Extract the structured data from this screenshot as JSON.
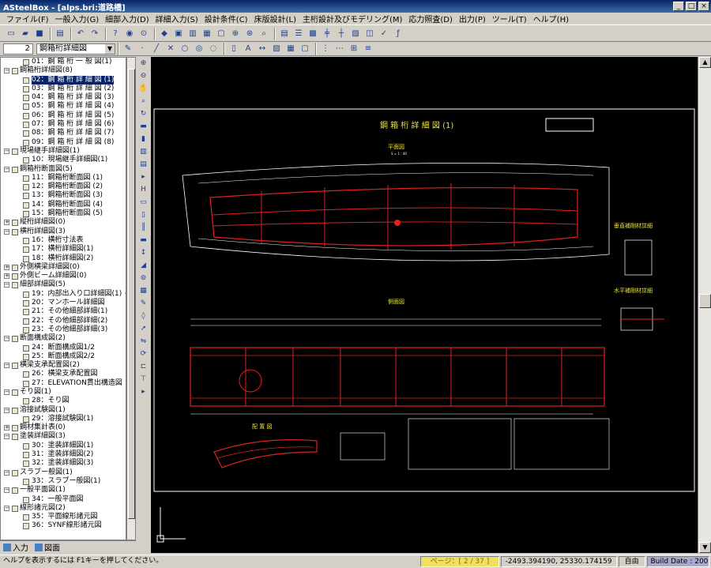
{
  "window": {
    "title": "ASteelBox - [alps.bri:道路橋]",
    "min": "_",
    "max": "□",
    "close": "×"
  },
  "menu": [
    "ファイル(F)",
    "一般入力(G)",
    "細部入力(D)",
    "詳細入力(S)",
    "設計条件(C)",
    "床版設計(L)",
    "主桁設計及びモデリング(M)",
    "応力照査(D)",
    "出力(P)",
    "ツール(T)",
    "ヘルプ(H)"
  ],
  "toolbar2": {
    "page_number": "2",
    "drawing_select": "鋼箱桁詳細図"
  },
  "tree": [
    {
      "level": 2,
      "text": "01：鋼 箱 桁 一 般 図(1)"
    },
    {
      "level": 1,
      "text": "鋼箱桁詳細図(8)",
      "toggle": "-"
    },
    {
      "level": 2,
      "text": "02：鋼 箱 桁 詳 細 図 (1)",
      "selected": true
    },
    {
      "level": 2,
      "text": "03：鋼 箱 桁 詳 細 図 (2)"
    },
    {
      "level": 2,
      "text": "04：鋼 箱 桁 詳 細 図 (3)"
    },
    {
      "level": 2,
      "text": "05：鋼 箱 桁 詳 細 図 (4)"
    },
    {
      "level": 2,
      "text": "06：鋼 箱 桁 詳 細 図 (5)"
    },
    {
      "level": 2,
      "text": "07：鋼 箱 桁 詳 細 図 (6)"
    },
    {
      "level": 2,
      "text": "08：鋼 箱 桁 詳 細 図 (7)"
    },
    {
      "level": 2,
      "text": "09：鋼 箱 桁 詳 細 図 (8)"
    },
    {
      "level": 1,
      "text": "現場継手詳細図(1)",
      "toggle": "-"
    },
    {
      "level": 2,
      "text": "10：現場継手詳細図(1)"
    },
    {
      "level": 1,
      "text": "鋼箱桁断面図(5)",
      "toggle": "-"
    },
    {
      "level": 2,
      "text": "11：鋼箱桁断面図 (1)"
    },
    {
      "level": 2,
      "text": "12：鋼箱桁断面図 (2)"
    },
    {
      "level": 2,
      "text": "13：鋼箱桁断面図 (3)"
    },
    {
      "level": 2,
      "text": "14：鋼箱桁断面図 (4)"
    },
    {
      "level": 2,
      "text": "15：鋼箱桁断面図 (5)"
    },
    {
      "level": 1,
      "text": "縦桁詳細図(0)",
      "toggle": "+"
    },
    {
      "level": 1,
      "text": "横桁詳細図(3)",
      "toggle": "-"
    },
    {
      "level": 2,
      "text": "16：横桁寸法表"
    },
    {
      "level": 2,
      "text": "17：横桁詳細図(1)"
    },
    {
      "level": 2,
      "text": "18：横桁詳細図(2)"
    },
    {
      "level": 1,
      "text": "外側横梁詳細図(0)",
      "toggle": "+"
    },
    {
      "level": 1,
      "text": "外側ビーム詳細図(0)",
      "toggle": "+"
    },
    {
      "level": 1,
      "text": "細部詳細図(5)",
      "toggle": "-"
    },
    {
      "level": 2,
      "text": "19：内部出入り口詳細図(1) ~"
    },
    {
      "level": 2,
      "text": "20：マンホール詳細図"
    },
    {
      "level": 2,
      "text": "21：その他細部詳細(1)"
    },
    {
      "level": 2,
      "text": "22：その他細部詳細(2)"
    },
    {
      "level": 2,
      "text": "23：その他細部詳細(3)"
    },
    {
      "level": 1,
      "text": "断面構成図(2)",
      "toggle": "-"
    },
    {
      "level": 2,
      "text": "24：断面構成図1/2"
    },
    {
      "level": 2,
      "text": "25：断面構成図2/2"
    },
    {
      "level": 1,
      "text": "横梁支承配置図(2)",
      "toggle": "-"
    },
    {
      "level": 2,
      "text": "26：横梁支承配置図"
    },
    {
      "level": 2,
      "text": "27：ELEVATION貫出構造図"
    },
    {
      "level": 1,
      "text": "そり図(1)",
      "toggle": "-"
    },
    {
      "level": 2,
      "text": "28：そり図"
    },
    {
      "level": 1,
      "text": "溶接試験図(1)",
      "toggle": "-"
    },
    {
      "level": 2,
      "text": "29：溶接試験図(1)"
    },
    {
      "level": 1,
      "text": "鋼材集計表(0)",
      "toggle": "+"
    },
    {
      "level": 1,
      "text": "塗装詳細図(3)",
      "toggle": "-"
    },
    {
      "level": 2,
      "text": "30：塗装詳細図(1)"
    },
    {
      "level": 2,
      "text": "31：塗装詳細図(2)"
    },
    {
      "level": 2,
      "text": "32：塗装詳細図(3)"
    },
    {
      "level": 1,
      "text": "スラブー般図(1)",
      "toggle": "-"
    },
    {
      "level": 2,
      "text": "33：スラブー般図(1)"
    },
    {
      "level": 1,
      "text": "一般平面図(1)",
      "toggle": "-"
    },
    {
      "level": 2,
      "text": "34：一般平面図"
    },
    {
      "level": 1,
      "text": "線形諸元図(2)",
      "toggle": "-"
    },
    {
      "level": 2,
      "text": "35：平面線形諸元図"
    },
    {
      "level": 2,
      "text": "36：SYNF線形諸元図"
    }
  ],
  "tabs": {
    "input": "入力",
    "drawing": "図面"
  },
  "drawing": {
    "title": "鋼 箱 桁 詳 細 図 (1)",
    "plan_label": "平面図",
    "side_label": "側面図",
    "layout_label": "配 置 図",
    "vertical_detail": "垂直補剛材詳細",
    "horizontal_detail": "水平補剛材詳細",
    "scale": "S = 1 : 40"
  },
  "status": {
    "message": "ヘルプを表示するには F1キーを押してください。",
    "page": "ページ：[ 2 / 37 ]",
    "coords": "-2493.394190, 25330.174159",
    "mode": "自由",
    "build": "Build Date : 20051208"
  },
  "colors": {
    "drawing_bg": "#000000",
    "red_line": "#e02020",
    "yellow_text": "#e8e040",
    "white_line": "#ffffff",
    "selection": "#0a246a",
    "page_panel": "#f0e060"
  }
}
